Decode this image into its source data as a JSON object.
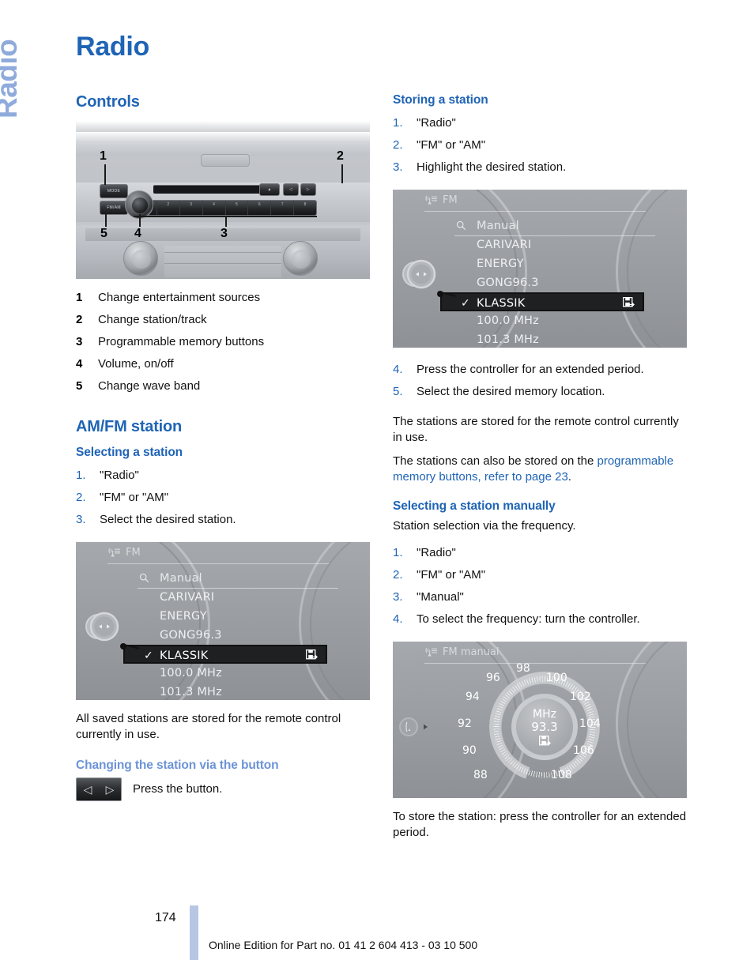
{
  "chapter_tab": "Radio",
  "page_title": "Radio",
  "left": {
    "controls": {
      "heading": "Controls",
      "photo": {
        "name": "car-radio-unit-photo",
        "mode_button": "MODE",
        "band_button": "FM/AM",
        "preset_labels": [
          "1",
          "2",
          "3",
          "4",
          "5",
          "6",
          "7",
          "8"
        ],
        "eject_glyph": "▲",
        "prev_glyph": "◁",
        "next_glyph": "▷",
        "callouts": [
          "1",
          "2",
          "3",
          "4",
          "5"
        ]
      },
      "legend": [
        {
          "num": "1",
          "text": "Change entertainment sources"
        },
        {
          "num": "2",
          "text": "Change station/track"
        },
        {
          "num": "3",
          "text": "Programmable memory buttons"
        },
        {
          "num": "4",
          "text": "Volume, on/off"
        },
        {
          "num": "5",
          "text": "Change wave band"
        }
      ]
    },
    "amfm": {
      "heading": "AM/FM station",
      "selecting": {
        "heading": "Selecting a station",
        "steps": [
          "\"Radio\"",
          "\"FM\" or \"AM\"",
          "Select the desired station."
        ],
        "note": "All saved stations are stored for the remote control currently in use."
      },
      "changing": {
        "heading": "Changing the station via the button",
        "caption": "Press the button.",
        "button_left_glyph": "◁",
        "button_right_glyph": "▷"
      }
    }
  },
  "right": {
    "storing": {
      "heading": "Storing a station",
      "steps_a": [
        "\"Radio\"",
        "\"FM\" or \"AM\"",
        "Highlight the desired station."
      ],
      "steps_b": [
        "Press the controller for an extended period.",
        "Select the desired memory location."
      ],
      "note1": "The stations are stored for the remote control currently in use.",
      "note2_prefix": "The stations can also be stored on the ",
      "note2_link": "programmable memory buttons, refer to page 23",
      "note2_suffix": "."
    },
    "manual": {
      "heading": "Selecting a station manually",
      "intro": "Station selection via the frequency.",
      "steps": [
        "\"Radio\"",
        "\"FM\" or \"AM\"",
        "\"Manual\"",
        "To select the frequency: turn the controller."
      ],
      "note": "To store the station: press the controller for an extended period."
    }
  },
  "idrive_list": {
    "header_label": "FM",
    "manual_entry": "Manual",
    "rows": [
      {
        "label": "CARIVARI",
        "selected": false
      },
      {
        "label": "ENERGY",
        "selected": false
      },
      {
        "label": "GONG96.3",
        "selected": false
      },
      {
        "label": "KLASSIK",
        "selected": true
      },
      {
        "label": "100.0  MHz",
        "selected": false
      },
      {
        "label": "101.3  MHz",
        "selected": false
      }
    ],
    "check_glyph": "✓"
  },
  "idrive_manual": {
    "header_label": "FM manual",
    "unit": "MHz",
    "frequency": "93.3",
    "dial_labels": [
      "88",
      "90",
      "92",
      "94",
      "96",
      "98",
      "100",
      "102",
      "104",
      "106",
      "108"
    ],
    "needle_frequency": 93.3
  },
  "footer": {
    "page_number": "174",
    "edition_text": "Online Edition for Part no. 01 41 2 604 413 - 03 10 500"
  },
  "colors": {
    "heading_blue": "#1F64B5",
    "light_blue": "#6C93D6",
    "tab_blue": "#8FABDC",
    "footer_bar": "#b7c6e4"
  }
}
